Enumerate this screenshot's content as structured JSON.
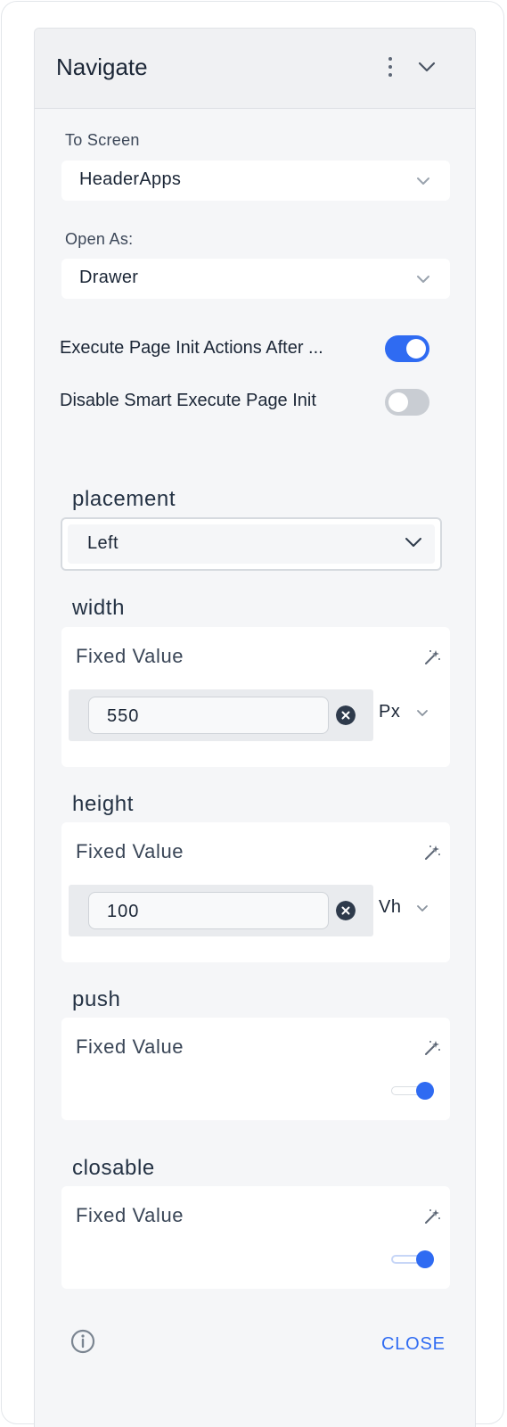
{
  "panel": {
    "title": "Navigate"
  },
  "to_screen": {
    "label": "To Screen",
    "value": "HeaderApps"
  },
  "open_as": {
    "label": "Open As:",
    "value": "Drawer"
  },
  "toggles": [
    {
      "label": "Execute Page Init Actions After ...",
      "on": true
    },
    {
      "label": "Disable Smart Execute Page Init",
      "on": false
    }
  ],
  "placement": {
    "label": "placement",
    "value": "Left"
  },
  "width": {
    "label": "width",
    "mode": "Fixed Value",
    "value": "550",
    "unit": "Px"
  },
  "height": {
    "label": "height",
    "mode": "Fixed Value",
    "value": "100",
    "unit": "Vh"
  },
  "push": {
    "label": "push",
    "mode": "Fixed Value",
    "enabled": true
  },
  "closable": {
    "label": "closable",
    "mode": "Fixed Value",
    "enabled": true
  },
  "footer": {
    "close_label": "CLOSE"
  },
  "colors": {
    "accent": "#2f6bf2",
    "panel_bg": "#f5f6f8"
  },
  "icons": [
    "kebab-menu-icon",
    "chevron-down-icon",
    "magic-wand-icon",
    "clear-icon",
    "info-icon"
  ]
}
